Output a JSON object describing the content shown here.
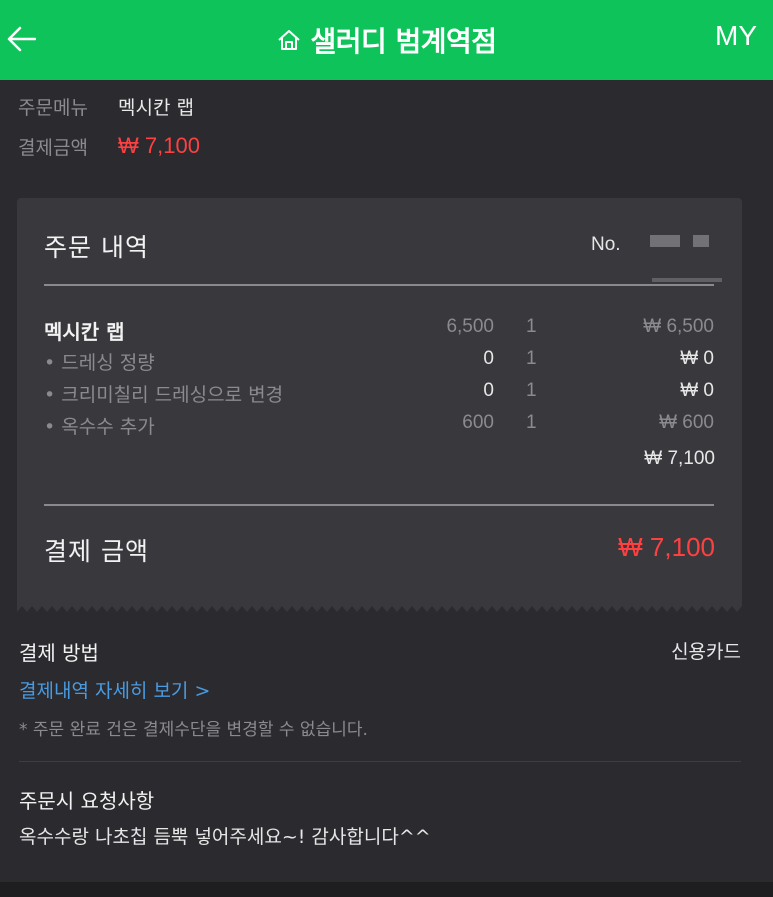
{
  "header": {
    "title": "샐러디 범계역점",
    "my_label": "MY",
    "back_icon": "arrow-left-icon",
    "store_icon": "home-icon",
    "background": "#0ec45a"
  },
  "summary": {
    "menu_label": "주문메뉴",
    "menu_value": "멕시칸 랩",
    "amount_label": "결제금액",
    "amount_value": "₩ 7,100"
  },
  "order": {
    "title": "주문 내역",
    "number_label": "No.",
    "items": [
      {
        "name": "멕시칸 랩",
        "price": "6,500",
        "qty": "1",
        "total": "₩ 6,500"
      },
      {
        "name": "• 드레싱 정량",
        "price": "0",
        "qty": "1",
        "total": "₩ 0"
      },
      {
        "name": "• 크리미칠리 드레싱으로 변경",
        "price": "0",
        "qty": "1",
        "total": "₩ 0"
      },
      {
        "name": "• 옥수수 추가",
        "price": "600",
        "qty": "1",
        "total": "₩ 600"
      }
    ],
    "subtotal": "₩ 7,100",
    "total_label": "결제 금액",
    "total_value": "₩ 7,100"
  },
  "payment": {
    "label": "결제 방법",
    "method": "신용카드",
    "detail_link": "결제내역 자세히 보기 >",
    "note": "* 주문 완료 건은 결제수단을 변경할 수 없습니다."
  },
  "request": {
    "label": "주문시 요청사항",
    "text": "옥수수랑 나초칩 듬뿍 넣어주세요~! 감사합니다^^"
  },
  "colors": {
    "accent_red": "#ff4040",
    "link_blue": "#4a9ae0"
  }
}
